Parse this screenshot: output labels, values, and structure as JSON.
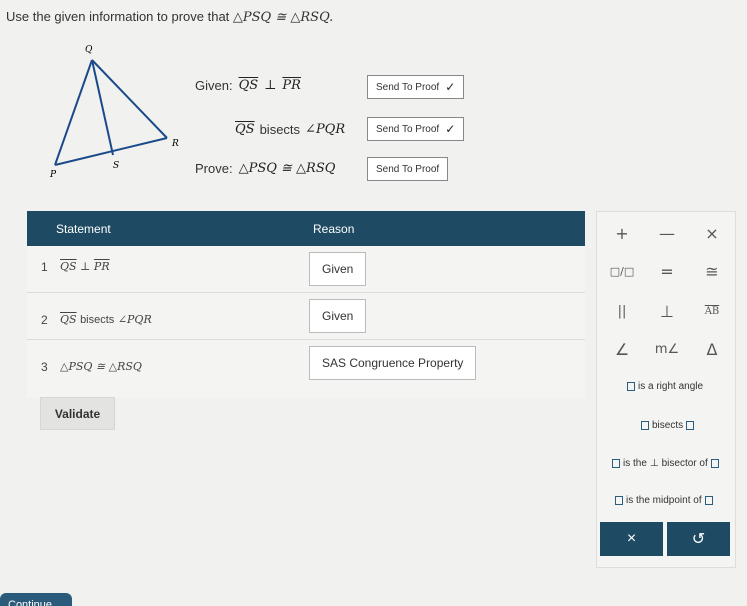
{
  "prompt": {
    "text": "Use the given information to prove that ",
    "math": "△PSQ ≅ △RSQ."
  },
  "figure": {
    "labels": {
      "q": "Q",
      "r": "R",
      "s": "S",
      "p": "P"
    }
  },
  "given": [
    {
      "label": "Given:",
      "math_a": "QS",
      "op": "⊥",
      "math_b": "PR",
      "button": "Send To Proof",
      "check": "✓"
    },
    {
      "label": "",
      "math_a": "QS",
      "op": "bisects",
      "math_b": "∠PQR",
      "button": "Send To Proof",
      "check": "✓"
    },
    {
      "label": "Prove:",
      "math_a": "△PSQ ≅ △RSQ",
      "op": "",
      "math_b": "",
      "button": "Send To Proof",
      "check": ""
    }
  ],
  "proof": {
    "headers": {
      "statement": "Statement",
      "reason": "Reason"
    },
    "rows": [
      {
        "num": "1",
        "stmt_a": "QS",
        "stmt_op": "⊥",
        "stmt_b": "PR",
        "reason": "Given"
      },
      {
        "num": "2",
        "stmt_a": "QS",
        "stmt_op": "bisects",
        "stmt_b": "∠PQR",
        "reason": "Given"
      },
      {
        "num": "3",
        "stmt_a": "△PSQ ≅ △RSQ",
        "stmt_op": "",
        "stmt_b": "",
        "reason": "SAS Congruence Property"
      }
    ],
    "validate_label": "Validate"
  },
  "symbols": {
    "plus": "+",
    "minus": "—",
    "times": "×",
    "fraction": "□/□",
    "equals": "=",
    "congruent": "≅",
    "parallel": "||",
    "perpendicular": "⊥",
    "segment": "AB",
    "angle": "∠",
    "measure_angle": "m∠",
    "triangle": "Δ",
    "right_angle_phrase": "is a right angle",
    "bisects_phrase": "bisects",
    "perp_bisector_phrase_a": "is the",
    "perp_bisector_phrase_b": "bisector of",
    "midpoint_phrase": "is the midpoint of",
    "clear": "×",
    "undo": "↺"
  },
  "continue_label": "Continue",
  "colors": {
    "header": "#1f4a63",
    "button": "#1f4a63"
  }
}
